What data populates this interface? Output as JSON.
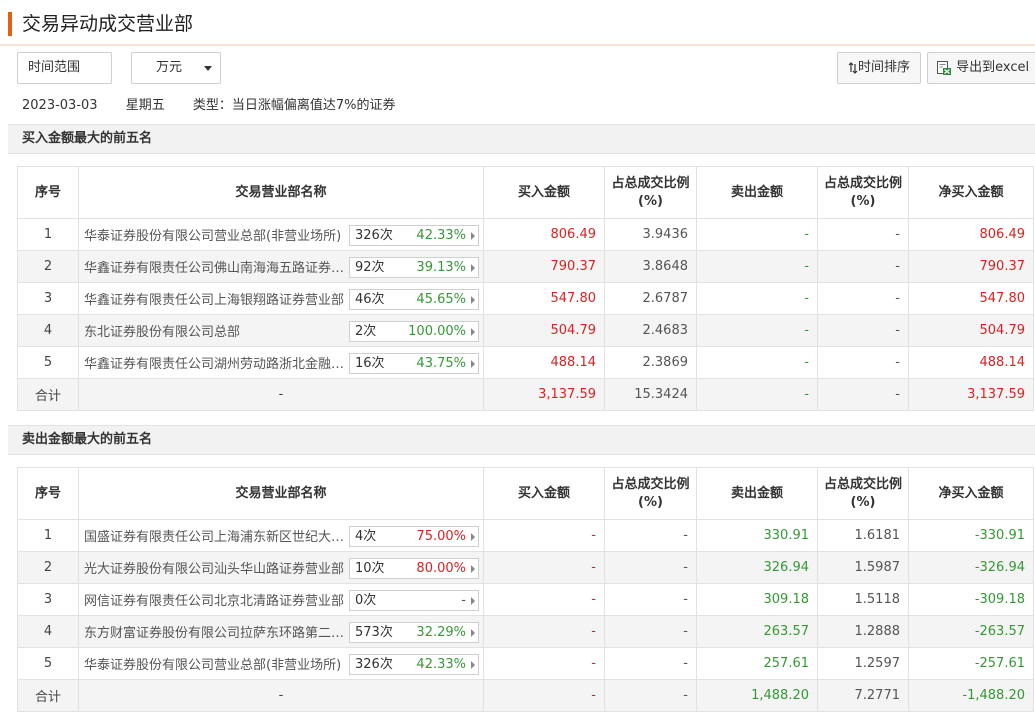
{
  "header": {
    "title": "交易异动成交营业部"
  },
  "toolbar": {
    "range_label": "时间范围",
    "unit_label": "万元",
    "sort_label": "时间排序",
    "export_label": "导出到excel"
  },
  "info": {
    "date": "2023-03-03",
    "weekday": "星期五",
    "type": "类型：当日涨幅偏离值达7%的证券"
  },
  "columns": {
    "seq": "序号",
    "name": "交易营业部名称",
    "buy": "买入金额",
    "buy_pct": "占总成交比例(%)",
    "sell": "卖出金额",
    "sell_pct": "占总成交比例(%)",
    "net": "净买入金额"
  },
  "buy_section": {
    "title": "买入金额最大的前五名",
    "rows": [
      {
        "seq": "1",
        "name": "华泰证券股份有限公司营业总部(非营业场所)",
        "times": "326次",
        "rate": "42.33%",
        "buy": "806.49",
        "buy_pct": "3.9436",
        "sell": "-",
        "sell_pct": "-",
        "net": "806.49"
      },
      {
        "seq": "2",
        "name": "华鑫证券有限责任公司佛山南海海五路证券营业部",
        "times": "92次",
        "rate": "39.13%",
        "buy": "790.37",
        "buy_pct": "3.8648",
        "sell": "-",
        "sell_pct": "-",
        "net": "790.37"
      },
      {
        "seq": "3",
        "name": "华鑫证券有限责任公司上海银翔路证券营业部",
        "times": "46次",
        "rate": "45.65%",
        "buy": "547.80",
        "buy_pct": "2.6787",
        "sell": "-",
        "sell_pct": "-",
        "net": "547.80"
      },
      {
        "seq": "4",
        "name": "东北证券股份有限公司总部",
        "times": "2次",
        "rate": "100.00%",
        "buy": "504.79",
        "buy_pct": "2.4683",
        "sell": "-",
        "sell_pct": "-",
        "net": "504.79"
      },
      {
        "seq": "5",
        "name": "华鑫证券有限责任公司湖州劳动路浙北金融中心证券营业部",
        "times": "16次",
        "rate": "43.75%",
        "buy": "488.14",
        "buy_pct": "2.3869",
        "sell": "-",
        "sell_pct": "-",
        "net": "488.14"
      }
    ],
    "total": {
      "label": "合计",
      "name": "-",
      "buy": "3,137.59",
      "buy_pct": "15.3424",
      "sell": "-",
      "sell_pct": "-",
      "net": "3,137.59"
    }
  },
  "sell_section": {
    "title": "卖出金额最大的前五名",
    "rows": [
      {
        "seq": "1",
        "name": "国盛证券有限责任公司上海浦东新区世纪大道证券营业部",
        "times": "4次",
        "rate": "75.00%",
        "buy": "-",
        "buy_pct": "-",
        "sell": "330.91",
        "sell_pct": "1.6181",
        "net": "-330.91"
      },
      {
        "seq": "2",
        "name": "光大证券股份有限公司汕头华山路证券营业部",
        "times": "10次",
        "rate": "80.00%",
        "buy": "-",
        "buy_pct": "-",
        "sell": "326.94",
        "sell_pct": "1.5987",
        "net": "-326.94"
      },
      {
        "seq": "3",
        "name": "网信证券有限责任公司北京北清路证券营业部",
        "times": "0次",
        "rate": "-",
        "buy": "-",
        "buy_pct": "-",
        "sell": "309.18",
        "sell_pct": "1.5118",
        "net": "-309.18"
      },
      {
        "seq": "4",
        "name": "东方财富证券股份有限公司拉萨东环路第二证券营业部",
        "times": "573次",
        "rate": "32.29%",
        "buy": "-",
        "buy_pct": "-",
        "sell": "263.57",
        "sell_pct": "1.2888",
        "net": "-263.57"
      },
      {
        "seq": "5",
        "name": "华泰证券股份有限公司营业总部(非营业场所)",
        "times": "326次",
        "rate": "42.33%",
        "buy": "-",
        "buy_pct": "-",
        "sell": "257.61",
        "sell_pct": "1.2597",
        "net": "-257.61"
      }
    ],
    "total": {
      "label": "合计",
      "name": "-",
      "buy": "-",
      "buy_pct": "-",
      "sell": "1,488.20",
      "sell_pct": "7.2771",
      "net": "-1,488.20"
    }
  },
  "colors": {
    "accent": "#e35f14",
    "up": "#e02020",
    "down": "#339933"
  },
  "icons": {
    "sort": "sort-arrows-icon",
    "export": "excel-export-icon",
    "dropdown": "caret-down-icon",
    "row_arrow": "triangle-right-icon"
  }
}
